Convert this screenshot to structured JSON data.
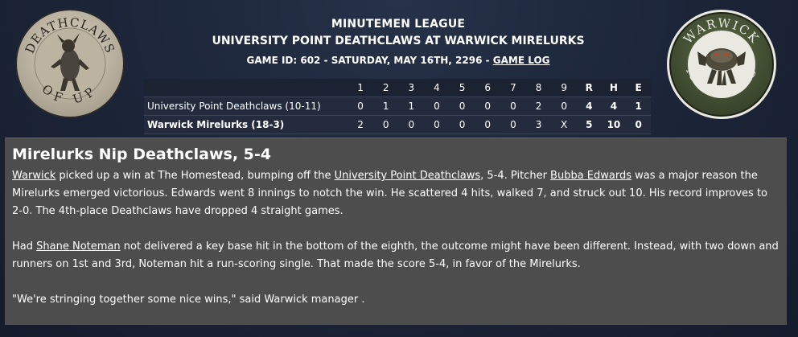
{
  "header": {
    "league": "MINUTEMEN LEAGUE",
    "matchup": "UNIVERSITY POINT DEATHCLAWS AT WARWICK MIRELURKS",
    "game_info": "GAME ID: 602 - SATURDAY, MAY 16TH, 2296 - ",
    "game_log_link": "GAME LOG"
  },
  "logos": {
    "left": {
      "top_text": "DEATHCLAWS",
      "bottom_text": "OF UP",
      "icon": "deathclaw-icon",
      "ring_color": "#c9bfae"
    },
    "right": {
      "top_text": "WARWICK",
      "bottom_text": "MIRELURKS",
      "icon": "mirelurk-icon",
      "ring_color": "#4b5a3a"
    }
  },
  "box_score": {
    "headers": [
      "1",
      "2",
      "3",
      "4",
      "5",
      "6",
      "7",
      "8",
      "9",
      "R",
      "H",
      "E"
    ],
    "rows": [
      {
        "team": "University Point Deathclaws (10-11)",
        "innings": [
          "0",
          "1",
          "1",
          "0",
          "0",
          "0",
          "0",
          "2",
          "0"
        ],
        "runs": "4",
        "hits": "4",
        "errors": "1"
      },
      {
        "team": "Warwick Mirelurks (18-3)",
        "innings": [
          "2",
          "0",
          "0",
          "0",
          "0",
          "0",
          "0",
          "3",
          "X"
        ],
        "runs": "5",
        "hits": "10",
        "errors": "0"
      }
    ]
  },
  "recap": {
    "headline": "Mirelurks Nip Deathclaws, 5-4",
    "p1": {
      "link1": "Warwick",
      "t1": " picked up a win at The Homestead, bumping off the ",
      "link2": "University Point Deathclaws",
      "t2": ", 5-4. Pitcher ",
      "link3": "Bubba Edwards",
      "t3": " was a major reason the Mirelurks emerged victorious. Edwards went 8 innings to notch the win. He scattered 4 hits, walked 7, and struck out 10. His record improves to 2-0. The 4th-place Deathclaws have dropped 4 straight games."
    },
    "p2": {
      "t1": "Had ",
      "link1": "Shane Noteman",
      "t2": " not delivered a key base hit in the bottom of the eighth, the outcome might have been different. Instead, with two down and runners on 1st and 3rd, Noteman hit a run-scoring single. That made the score 5-4, in favor of the Mirelurks."
    },
    "p3": "\"We're stringing together some nice wins,\" said Warwick manager ."
  }
}
